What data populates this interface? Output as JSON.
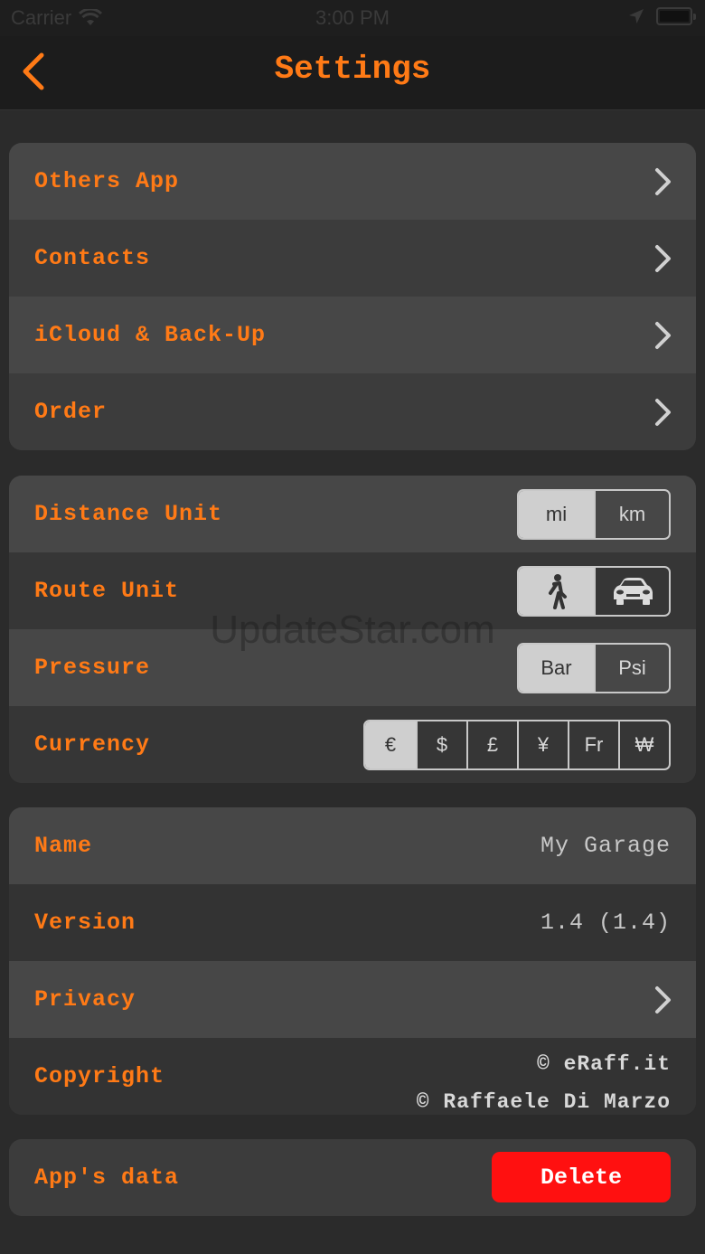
{
  "status_bar": {
    "carrier": "Carrier",
    "time": "3:00 PM"
  },
  "nav": {
    "title": "Settings",
    "accent_color": "#ff7a16"
  },
  "section_links": [
    {
      "label": "Others App"
    },
    {
      "label": "Contacts"
    },
    {
      "label": "iCloud & Back-Up"
    },
    {
      "label": "Order"
    }
  ],
  "units": {
    "distance": {
      "label": "Distance Unit",
      "options": [
        "mi",
        "km"
      ],
      "selected": "mi"
    },
    "route": {
      "label": "Route Unit",
      "options": [
        "walking-icon",
        "car-icon"
      ],
      "selected": "walking-icon"
    },
    "pressure": {
      "label": "Pressure",
      "options": [
        "Bar",
        "Psi"
      ],
      "selected": "Bar"
    },
    "currency": {
      "label": "Currency",
      "options": [
        "€",
        "$",
        "£",
        "¥",
        "Fr",
        "₩"
      ],
      "selected": "€"
    }
  },
  "info": {
    "name_label": "Name",
    "name_value": "My Garage",
    "version_label": "Version",
    "version_value": "1.4 (1.4)",
    "privacy_label": "Privacy",
    "copyright_label": "Copyright",
    "copyright_line1": "© eRaff.it",
    "copyright_line2": "© Raffaele Di Marzo"
  },
  "data_section": {
    "label": "App's data",
    "delete_label": "Delete",
    "delete_color": "#ff1010"
  },
  "watermark": "UpdateStar.com"
}
